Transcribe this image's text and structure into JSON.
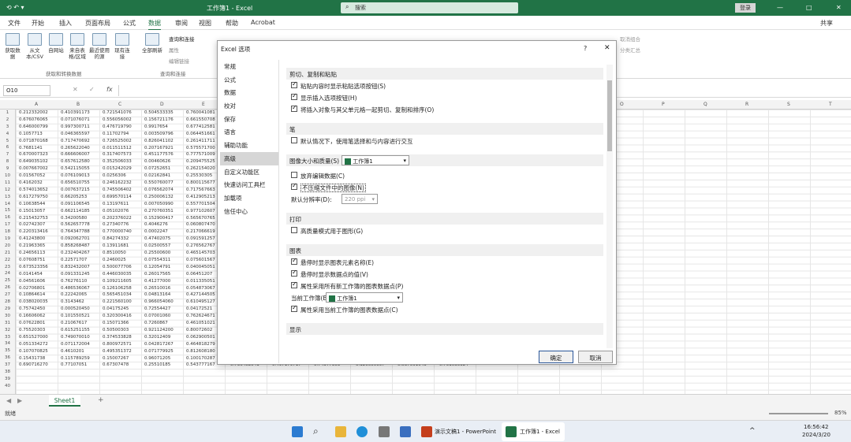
{
  "titlebar": {
    "filename": "工作簿1 - Excel",
    "search_placeholder": "搜索",
    "user_button": "登录",
    "min": "—",
    "max": "□",
    "close": "✕"
  },
  "ribbon_tabs": [
    "文件",
    "开始",
    "插入",
    "页面布局",
    "公式",
    "数据",
    "审阅",
    "视图",
    "帮助",
    "Acrobat"
  ],
  "share_label": "共享",
  "ribbon_buttons": [
    {
      "label": "获取数据",
      "name": "get-data-button"
    },
    {
      "label": "从文本/CSV",
      "name": "from-text-csv-button"
    },
    {
      "label": "自网站",
      "name": "from-web-button"
    },
    {
      "label": "来自表格/区域",
      "name": "from-table-button"
    },
    {
      "label": "最近使用的源",
      "name": "recent-sources-button"
    },
    {
      "label": "现有连接",
      "name": "existing-connections-button"
    },
    {
      "label": "全部刷新",
      "name": "refresh-all-button"
    }
  ],
  "ribbon_groups": [
    "获取和转换数据",
    "查询和连接"
  ],
  "ribbon_small": [
    "查询和连接",
    "属性",
    "编辑链接"
  ],
  "ribbon_right": [
    "取消组合",
    "分类汇总"
  ],
  "namebox": "O10",
  "fx": "fx",
  "columns": [
    "A",
    "B",
    "C",
    "D",
    "E",
    "F",
    "G",
    "H",
    "I",
    "J",
    "K",
    "L",
    "M",
    "N",
    "O",
    "P",
    "Q",
    "R",
    "S",
    "T"
  ],
  "rows": [
    "1",
    "2",
    "3",
    "4",
    "5",
    "6",
    "7",
    "8",
    "9",
    "10",
    "11",
    "12",
    "13",
    "14",
    "15",
    "16",
    "17",
    "18",
    "19",
    "20",
    "21",
    "22",
    "23",
    "24",
    "25",
    "26",
    "27",
    "28",
    "29",
    "30",
    "31",
    "32",
    "33",
    "34",
    "35",
    "36",
    "37",
    "38",
    "39",
    "40"
  ],
  "cell_values": [
    [
      "0.212332002",
      "0.410391173",
      "0.721541076",
      "0.504533335",
      "0.760041081"
    ],
    [
      "0.676076065",
      "0.071076071",
      "0.556056002",
      "0.156721176",
      "0.661550708"
    ],
    [
      "0.646000799",
      "0.997300711",
      "0.476719790",
      "0.9917654",
      "0.677412581"
    ],
    [
      "0.1057713",
      "0.046365597",
      "0.11702794",
      "0.003509796",
      "0.064451661"
    ],
    [
      "0.071870168",
      "0.717470692",
      "0.726525002",
      "0.826041102",
      "0.261411711"
    ],
    [
      "0.7681141",
      "0.265622040",
      "0.011511512",
      "0.207167921",
      "0.575571700"
    ],
    [
      "0.670007323",
      "0.666606007",
      "0.317407573",
      "0.451177576",
      "0.777571009"
    ],
    [
      "0.649035102",
      "0.657612580",
      "0.352506033",
      "0.00460626",
      "0.209475525"
    ],
    [
      "0.007667002",
      "0.542115055",
      "0.015242029",
      "0.07252651",
      "0.262154020"
    ],
    [
      "0.01567052",
      "0.076109013",
      "0.0256306",
      "0.02162841",
      "0.25530305"
    ],
    [
      "0.4162032",
      "0.656510755",
      "0.246162232",
      "0.550760077",
      "0.800115677"
    ],
    [
      "0.574013652",
      "0.007637215",
      "0.745506402",
      "0.076562074",
      "0.717567663"
    ],
    [
      "0.617279750",
      "0.66205253",
      "0.699570114",
      "0.250006132",
      "0.412905213"
    ],
    [
      "0.10638544",
      "0.091106545",
      "0.13197611",
      "0.007050990",
      "0.557701504"
    ],
    [
      "0.15013057",
      "0.662114185",
      "0.05102076",
      "0.270760351",
      "0.977102607"
    ],
    [
      "0.215432753",
      "0.34200580",
      "0.202376022",
      "0.152900417",
      "0.565670765"
    ],
    [
      "0.02742307",
      "0.562657778",
      "0.27340776",
      "0.4046276",
      "0.060807470"
    ],
    [
      "0.220313416",
      "0.764347788",
      "0.770000740",
      "0.0002247",
      "0.217066619"
    ],
    [
      "0.41243800",
      "0.092062701",
      "0.84274332",
      "0.47402075",
      "0.091591257"
    ],
    [
      "0.21963365",
      "0.858268487",
      "0.13911681",
      "0.02500557",
      "0.276562767"
    ],
    [
      "0.24656113",
      "0.232404267",
      "0.8510050",
      "0.25500600",
      "0.465145703"
    ],
    [
      "0.07608751",
      "0.22571707",
      "0.2460025",
      "0.07554311",
      "0.075601567"
    ],
    [
      "0.673523356",
      "0.832432007",
      "0.500077706",
      "0.12054791",
      "0.040045051"
    ],
    [
      "0.0141454",
      "0.091331245",
      "0.446030035",
      "0.26017565",
      "0.06451207"
    ],
    [
      "0.04561606",
      "0.76276110",
      "0.109211605",
      "0.41277000",
      "0.011335051"
    ],
    [
      "0.02706801",
      "0.486536067",
      "0.126106258",
      "0.26510016",
      "0.054873067"
    ],
    [
      "0.10864614",
      "0.22242065",
      "0.565451034",
      "0.04813164",
      "0.427144505"
    ],
    [
      "0.038020035",
      "0.3143462",
      "0.221560100",
      "0.966054060",
      "0.610495127"
    ],
    [
      "0.75742450",
      "0.000520450",
      "0.04175245",
      "0.72554427",
      "0.04172521"
    ],
    [
      "0.16606062",
      "0.101550521",
      "0.320300416",
      "0.07001060",
      "0.762624671"
    ],
    [
      "0.07622801",
      "0.21067617",
      "0.15071366",
      "0.7260867",
      "0.461051021"
    ],
    [
      "0.75520303",
      "0.615251155",
      "0.50500303",
      "0.921124200",
      "0.80072602"
    ],
    [
      "0.651527000",
      "0.749070010",
      "0.374533828",
      "0.32012409",
      "0.062900501"
    ],
    [
      "0.051334272",
      "0.071172004",
      "0.800972571",
      "0.042817267",
      "0.464818279"
    ],
    [
      "0.107070825",
      "0.4610201",
      "0.495351372",
      "0.071779925",
      "0.812608180"
    ],
    [
      "0.15431738",
      "0.115789259",
      "0.15007267",
      "0.96071205",
      "0.100170287"
    ],
    [
      "0.690716270",
      "0.77107051",
      "0.67307478",
      "0.25510185",
      "0.543777167"
    ]
  ],
  "right_values": [
    [
      "0.762358275",
      "0.715052291",
      "0.615674387",
      "0.230582270",
      "0.76551447",
      "0.41272225"
    ],
    [
      "0.512903802",
      "0.420050112",
      "0.659551502",
      "0.913590500",
      "0.755558585",
      "0.01261958"
    ],
    [
      "0.867170146",
      "0.437202757",
      "0.157431451",
      "0.45680301",
      "0.176073730",
      "0.52411124"
    ],
    [
      "0.736452541",
      "0.497179717",
      "0.74377303",
      "0.120050957",
      "0.537591043",
      "0.751035324"
    ]
  ],
  "dialog": {
    "title": "Excel 选项",
    "help": "?",
    "close": "✕",
    "nav": [
      "常规",
      "公式",
      "数据",
      "校对",
      "保存",
      "语言",
      "辅助功能",
      "高级",
      "自定义功能区",
      "快速访问工具栏",
      "加载项",
      "信任中心"
    ],
    "selected_nav": "高级",
    "sections": {
      "cut_copy": {
        "header": "剪切、复制和粘贴",
        "opts": [
          {
            "label": "粘贴内容时显示粘贴选项按钮(S)",
            "checked": true
          },
          {
            "label": "显示插入选项按钮(H)",
            "checked": true
          },
          {
            "label": "将插入对象与其父单元格一起剪切、复制和排序(O)",
            "checked": true
          }
        ]
      },
      "pen": {
        "header": "笔",
        "opts": [
          {
            "label": "默认情况下，使用笔选择和与内容进行交互",
            "checked": false
          }
        ]
      },
      "image_size": {
        "header": "图像大小和质量(S)",
        "workbook": "工作簿1",
        "opts": [
          {
            "label": "放弃编辑数据(C)",
            "checked": false
          },
          {
            "label": "不压缩文件中的图像(N)",
            "checked": true
          }
        ],
        "resolution_label": "默认分辨率(D):",
        "resolution": "220 ppi"
      },
      "print": {
        "header": "打印",
        "opts": [
          {
            "label": "高质量模式用于图形(G)",
            "checked": false
          }
        ]
      },
      "chart": {
        "header": "图表",
        "opts": [
          {
            "label": "悬停时显示图表元素名称(E)",
            "checked": true
          },
          {
            "label": "悬停时显示数据点的值(V)",
            "checked": true
          },
          {
            "label": "属性采用所有新工作簿的图表数据点(P)",
            "checked": true
          }
        ],
        "current_workbook_label": "当前工作簿(B):",
        "current_workbook": "工作簿1",
        "last_opt": {
          "label": "属性采用当前工作簿的图表数据点(C)",
          "checked": true
        }
      },
      "display": {
        "header": "显示"
      }
    },
    "ok": "确定",
    "cancel": "取消"
  },
  "sheet": {
    "tab": "Sheet1",
    "add": "+"
  },
  "status": {
    "ready": "就绪",
    "zoom": "85%"
  },
  "taskbar": {
    "ppt_label": "演示文稿1 - PowerPoint",
    "excel_label": "工作簿1 - Excel",
    "time": "16:56:42",
    "date": "2024/3/20"
  }
}
